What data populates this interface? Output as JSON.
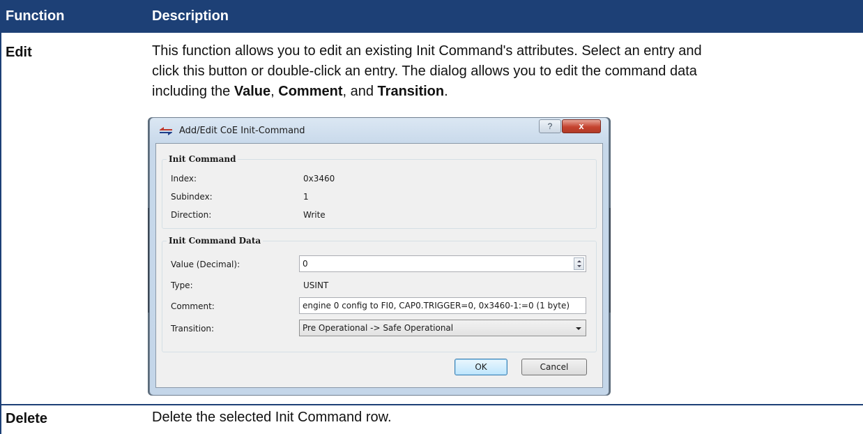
{
  "table": {
    "header": {
      "function": "Function",
      "description": "Description"
    },
    "rows": [
      {
        "function": "Edit",
        "desc_line1": "This function allows you to edit an existing Init Command's attributes. Select an entry and",
        "desc_line2": "click this button or double-click an entry. The dialog allows you to edit the command data",
        "desc_line3_prefix": "including the ",
        "bold1": "Value",
        "sep1": ", ",
        "bold2": "Comment",
        "sep2": ", and ",
        "bold3": "Transition",
        "end": "."
      },
      {
        "function": "Delete",
        "description": "Delete the selected Init Command row."
      }
    ]
  },
  "dialog": {
    "title": "Add/Edit CoE Init-Command",
    "help_glyph": "?",
    "close_glyph": "x",
    "init_command": {
      "title": "Init Command",
      "index_label": "Index:",
      "index_value": "0x3460",
      "subindex_label": "Subindex:",
      "subindex_value": "1",
      "direction_label": "Direction:",
      "direction_value": "Write"
    },
    "init_command_data": {
      "title": "Init Command Data",
      "value_label": "Value (Decimal):",
      "value": "0",
      "type_label": "Type:",
      "type_value": "USINT",
      "comment_label": "Comment:",
      "comment_value": "engine 0 config to FI0, CAP0.TRIGGER=0, 0x3460-1:=0 (1 byte)",
      "transition_label": "Transition:",
      "transition_value": "Pre Operational -> Safe Operational"
    },
    "ok_label": "OK",
    "cancel_label": "Cancel"
  },
  "colors": {
    "header_bg": "#1d4076",
    "close_red": "#c5432f"
  }
}
